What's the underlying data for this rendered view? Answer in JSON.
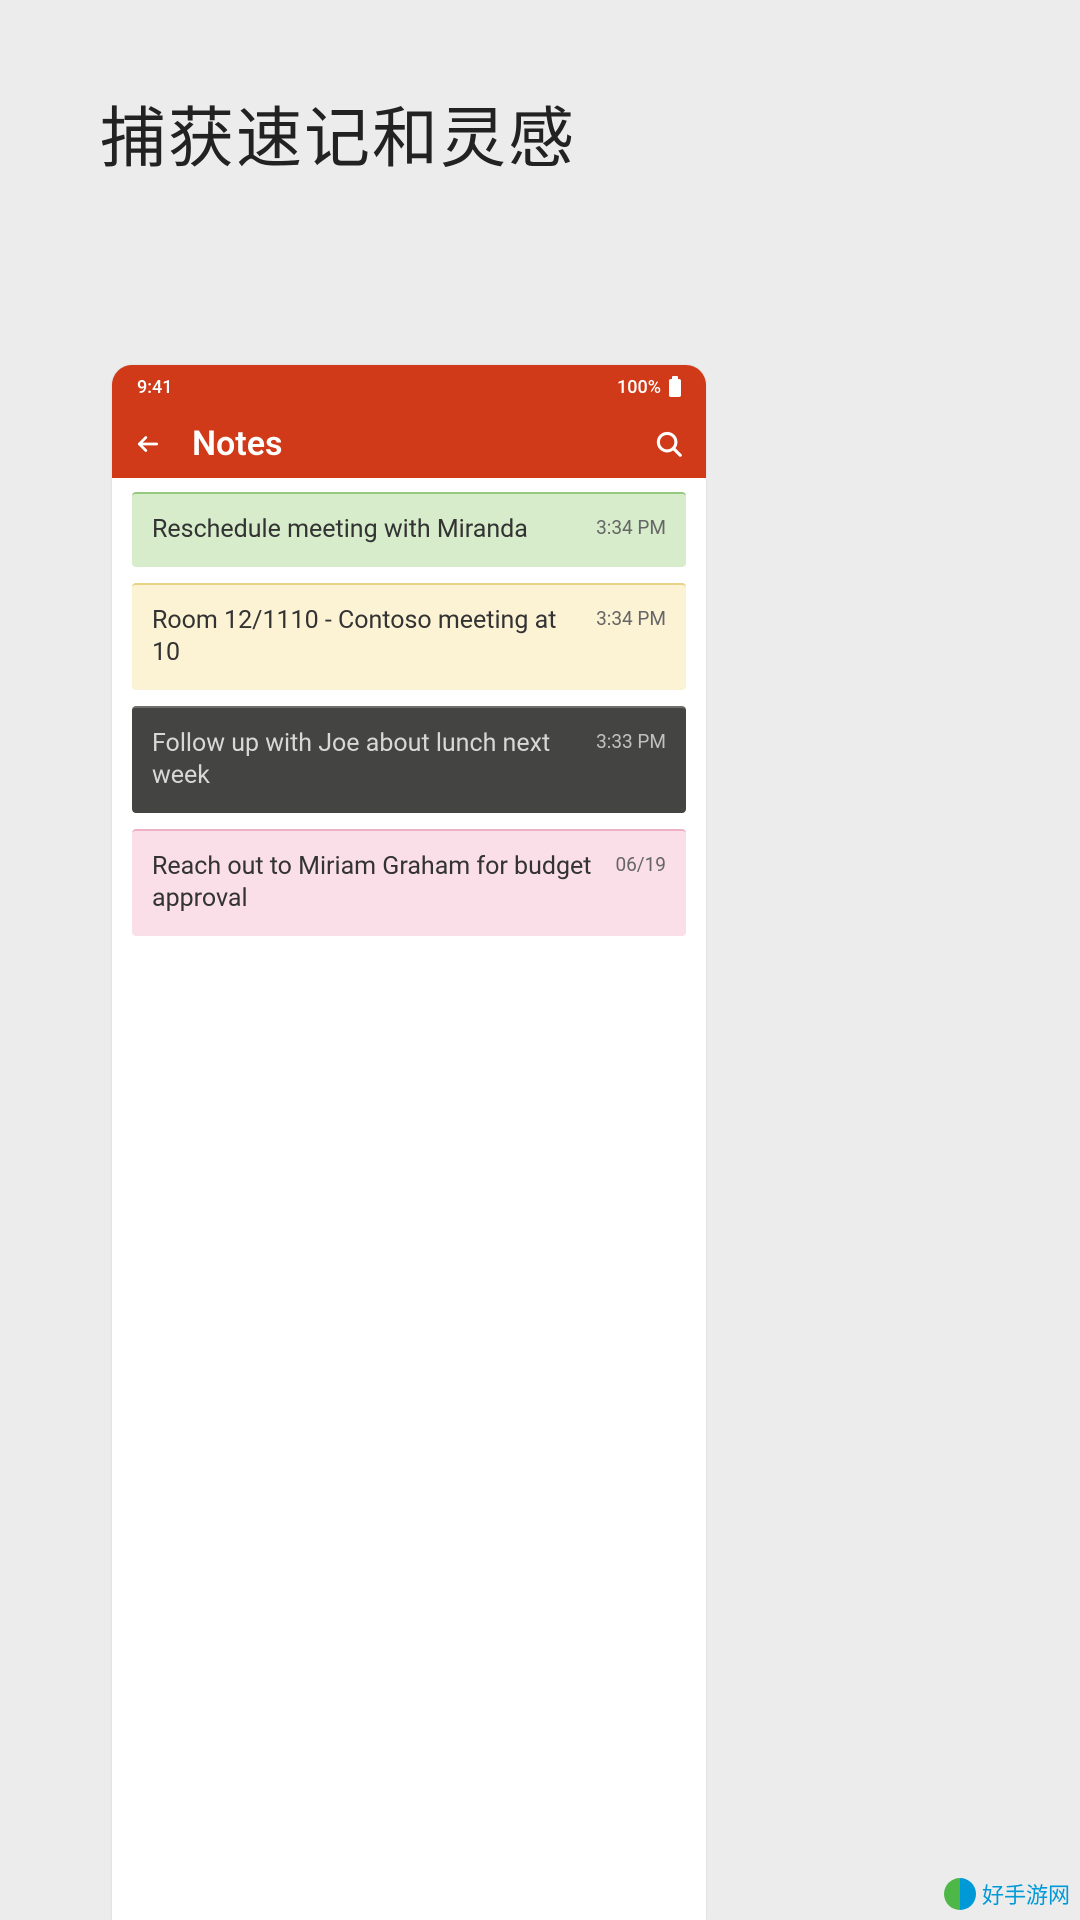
{
  "promo": {
    "title": "捕获速记和灵感"
  },
  "status_bar": {
    "time": "9:41",
    "battery": "100%"
  },
  "app_bar": {
    "title": "Notes"
  },
  "notes": [
    {
      "text": "Reschedule meeting with Miranda",
      "time": "3:34 PM",
      "color": "green"
    },
    {
      "text": "Room 12/1110 - Contoso meeting at 10",
      "time": "3:34 PM",
      "color": "yellow"
    },
    {
      "text": "Follow up with Joe about lunch next week",
      "time": "3:33 PM",
      "color": "dark"
    },
    {
      "text": "Reach out to Miriam Graham for budget approval",
      "time": "06/19",
      "color": "pink"
    }
  ],
  "watermark": {
    "text": "好手游网"
  }
}
